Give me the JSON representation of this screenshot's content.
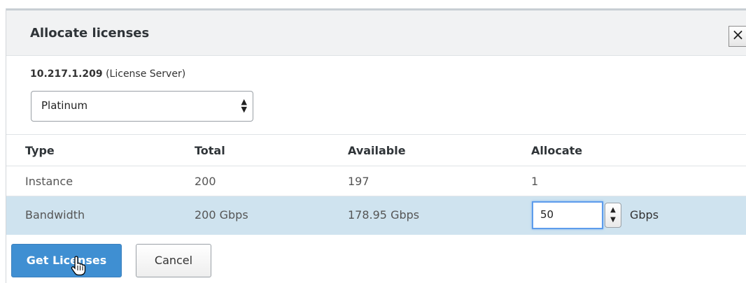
{
  "dialog": {
    "title": "Allocate licenses",
    "close_label": "×"
  },
  "server": {
    "ip": "10.217.1.209",
    "role": "(License Server)"
  },
  "edition_select": {
    "value": "Platinum"
  },
  "table": {
    "headers": [
      "Type",
      "Total",
      "Available",
      "Allocate"
    ],
    "rows": [
      {
        "type": "Instance",
        "total": "200",
        "available": "197",
        "allocate": "1"
      },
      {
        "type": "Bandwidth",
        "total": "200 Gbps",
        "available": "178.95 Gbps",
        "allocate": "50",
        "unit": "Gbps"
      }
    ]
  },
  "buttons": {
    "get_licenses": "Get Licenses",
    "cancel": "Cancel"
  },
  "colors": {
    "primary_button": "#3f8fd2",
    "selected_row": "#cfe3ef",
    "header_bg": "#f1f2f3"
  }
}
